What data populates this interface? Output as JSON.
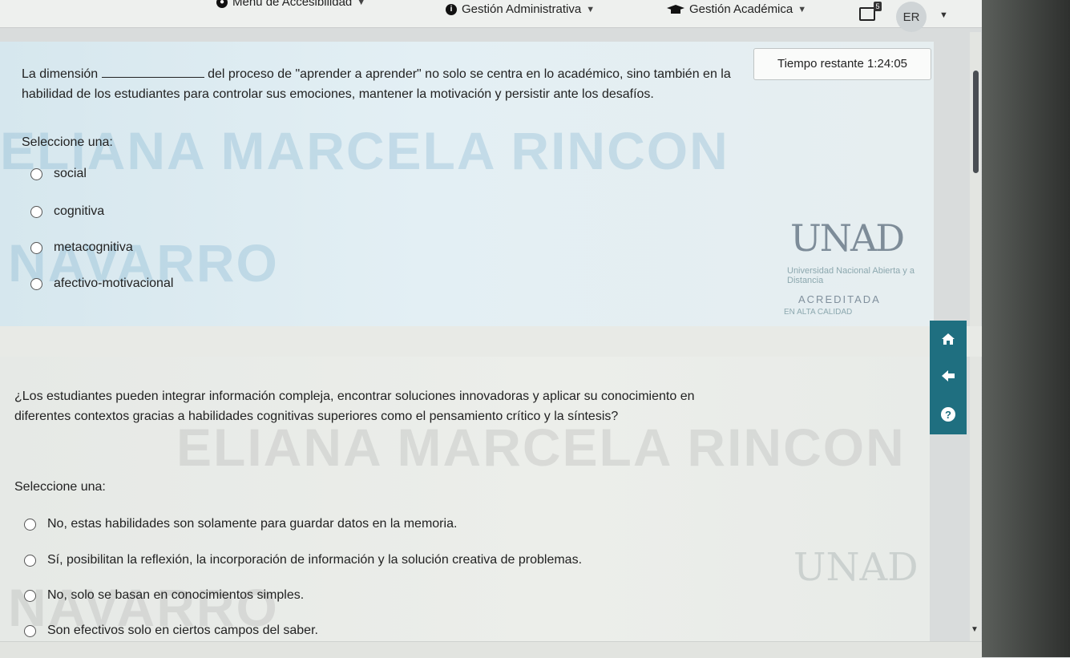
{
  "nav": {
    "accessibility_menu": "Menú de Accesibilidad",
    "admin_menu": "Gestión Administrativa",
    "academic_menu": "Gestión Académica",
    "messages_badge": "5",
    "user_initials": "ER"
  },
  "timer": {
    "label": "Tiempo restante",
    "value": "1:24:05"
  },
  "question1": {
    "text_before_blank": "La dimensión",
    "text_after_blank": "del proceso de \"aprender a aprender\" no solo se centra en lo académico, sino también en la",
    "text_line2": "habilidad de los estudiantes para controlar sus emociones, mantener la motivación y persistir ante los desafíos.",
    "select_label": "Seleccione una:",
    "options": [
      "social",
      "cognitiva",
      "metacognitiva",
      "afectivo-motivacional"
    ]
  },
  "question2": {
    "text_line1": "¿Los estudiantes pueden integrar información compleja, encontrar soluciones innovadoras y aplicar su conocimiento en",
    "text_line2": "diferentes contextos gracias a habilidades cognitivas superiores como el pensamiento crítico y la síntesis?",
    "select_label": "Seleccione una:",
    "options": [
      "No, estas habilidades son solamente para guardar datos en la memoria.",
      "Sí, posibilitan la reflexión, la incorporación de información y la solución creativa de problemas.",
      "No, solo se basan en conocimientos simples.",
      "Son efectivos solo en ciertos campos del saber."
    ]
  },
  "watermark": {
    "line1": "ELIANA MARCELA RINCON",
    "line2": "NAVARRO"
  },
  "logo": {
    "name": "UNAD",
    "subtitle": "Universidad Nacional Abierta y a Distancia",
    "accreditation": "ACREDITADA",
    "accreditation_sub": "EN ALTA CALIDAD"
  },
  "quicknav": {
    "home_icon": "home-icon",
    "back_icon": "back-arrow-icon",
    "help_icon": "help-icon",
    "help_glyph": "?"
  },
  "colors": {
    "accent": "#1f6f80",
    "question1_bg": "#dde9ee"
  }
}
